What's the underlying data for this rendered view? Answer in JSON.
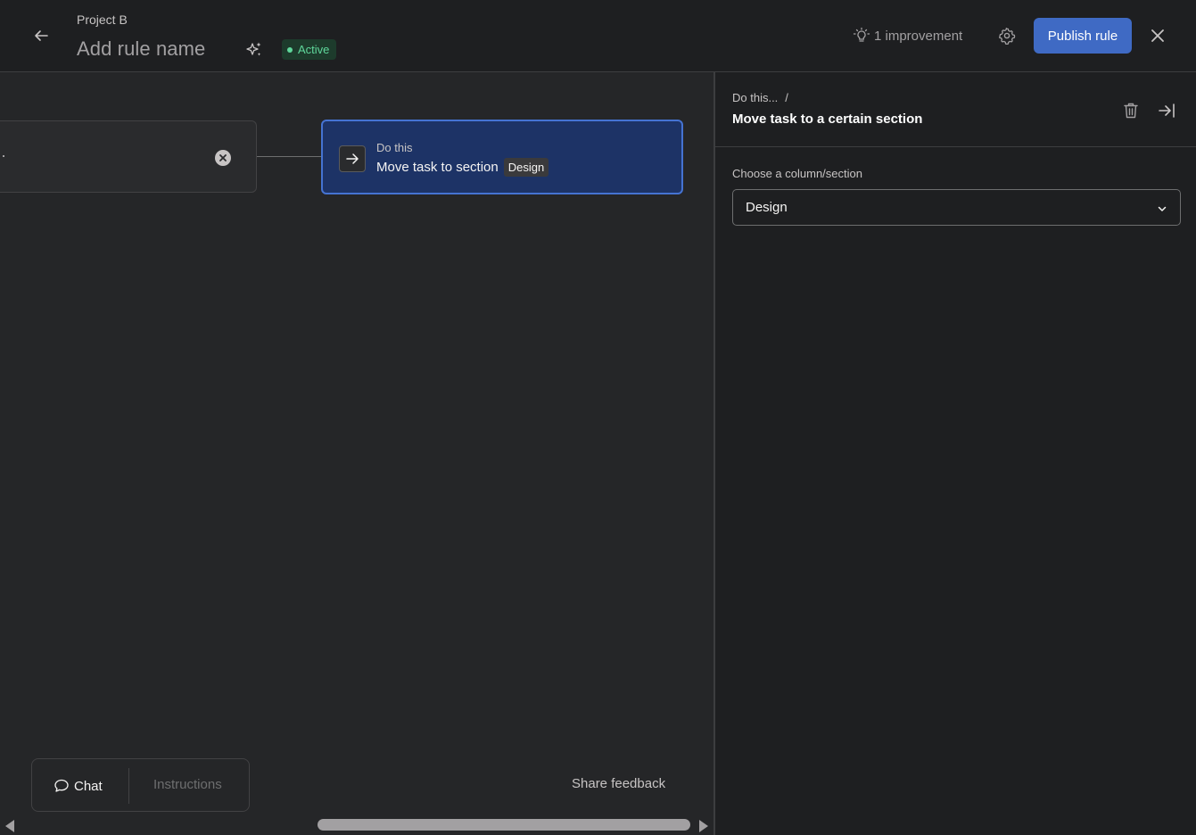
{
  "header": {
    "project_name": "Project B",
    "rule_name": "Add rule name",
    "status": "Active",
    "improvement": "1 improvement",
    "publish_label": "Publish rule"
  },
  "canvas": {
    "trigger_text": ".",
    "action": {
      "label": "Do this",
      "title": "Move task to section",
      "chip": "Design"
    },
    "tabs": {
      "chat": "Chat",
      "instructions": "Instructions"
    },
    "share_feedback": "Share feedback"
  },
  "panel": {
    "breadcrumb": "Do this...",
    "breadcrumb_separator": "/",
    "title": "Move task to a certain section",
    "field_label": "Choose a column/section",
    "selected_value": "Design"
  },
  "colors": {
    "accent": "#3f6ac4",
    "action_card_bg": "#1d3366",
    "status_green": "#5fd79b"
  }
}
